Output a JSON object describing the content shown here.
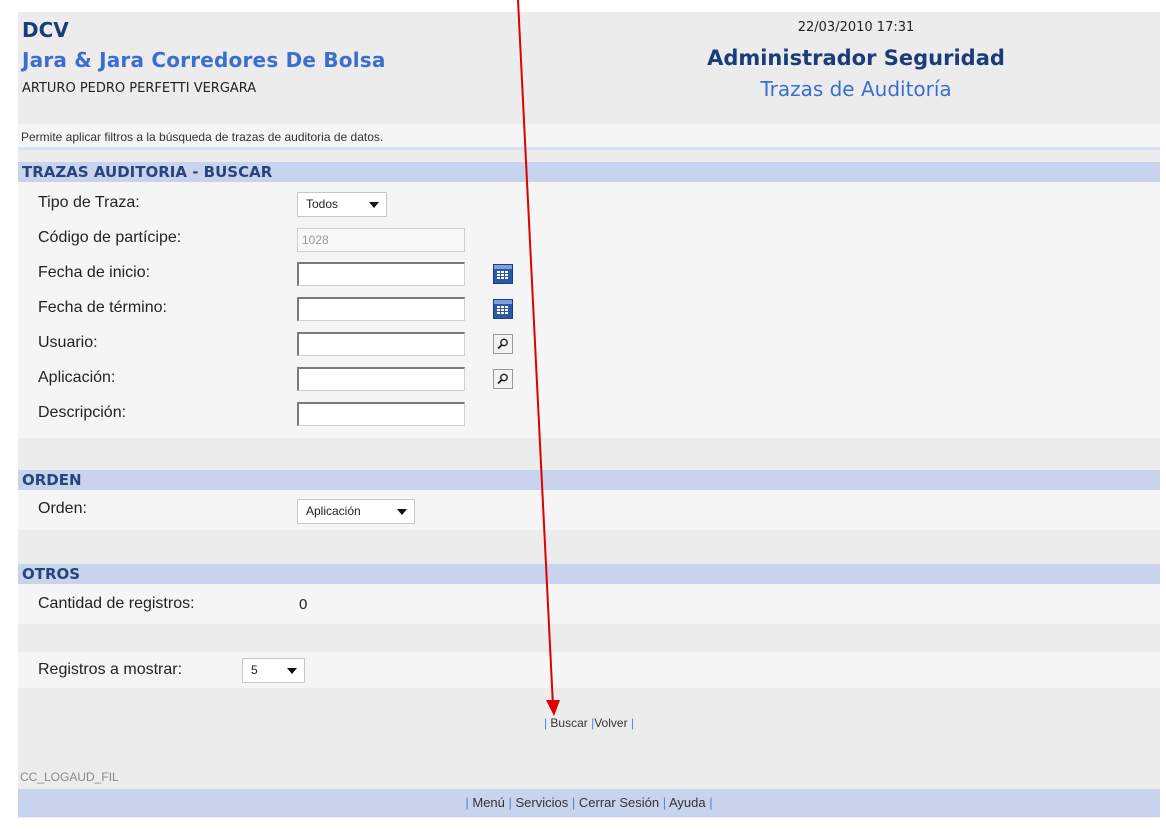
{
  "header": {
    "org": "DCV",
    "company": "Jara & Jara Corredores De Bolsa",
    "user": "ARTURO PEDRO PERFETTI VERGARA",
    "datetime": "22/03/2010 17:31",
    "app_title": "Administrador Seguridad",
    "page_title": "Trazas de Auditoría"
  },
  "description": "Permite aplicar filtros a la búsqueda de trazas de auditoria de datos.",
  "search": {
    "title": "TRAZAS AUDITORIA - BUSCAR",
    "tipo_label": "Tipo de Traza:",
    "tipo_value": "Todos",
    "codigo_label": "Código de partícipe:",
    "codigo_value": "1028",
    "inicio_label": "Fecha de inicio:",
    "termino_label": "Fecha de término:",
    "usuario_label": "Usuario:",
    "aplicacion_label": "Aplicación:",
    "descripcion_label": "Descripción:"
  },
  "orden": {
    "title": "ORDEN",
    "label": "Orden:",
    "value": "Aplicación"
  },
  "otros": {
    "title": "OTROS",
    "cantidad_label": "Cantidad de registros:",
    "cantidad_value": "0"
  },
  "registros": {
    "label": "Registros a mostrar:",
    "value": "5"
  },
  "actions": {
    "buscar": "Buscar",
    "volver": "Volver"
  },
  "screen_code": "CC_LOGAUD_FIL",
  "footer": {
    "menu": "Menú",
    "servicios": "Servicios",
    "cerrar": "Cerrar Sesión",
    "ayuda": "Ayuda"
  },
  "colors": {
    "section_header_bg": "#c8d4ee",
    "title_dark_blue": "#1a3c7a",
    "title_blue": "#3a6fd0",
    "annotation_arrow": "#e00000"
  }
}
